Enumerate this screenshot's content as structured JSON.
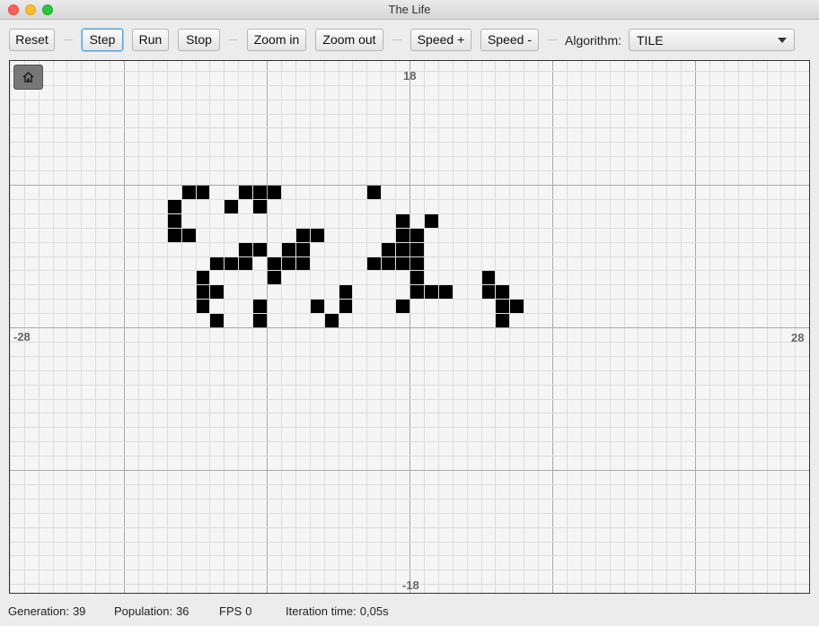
{
  "window": {
    "title": "The Life"
  },
  "toolbar": {
    "reset_label": "Reset",
    "step_label": "Step",
    "run_label": "Run",
    "stop_label": "Stop",
    "zoom_in_label": "Zoom in",
    "zoom_out_label": "Zoom out",
    "speed_plus_label": "Speed +",
    "speed_minus_label": "Speed -",
    "algorithm_label": "Algorithm:",
    "algorithm_value": "TILE"
  },
  "grid": {
    "axis_labels": {
      "top": "18",
      "bottom": "-18",
      "left": "-28",
      "right": "28"
    },
    "x_range": [
      -28,
      28
    ],
    "y_range": [
      -18,
      18
    ],
    "major_every": 10,
    "live_cells": [
      [
        -14,
        1
      ],
      [
        -11,
        1
      ],
      [
        -6,
        1
      ],
      [
        6,
        1
      ],
      [
        -15,
        2
      ],
      [
        -11,
        2
      ],
      [
        -7,
        2
      ],
      [
        -5,
        2
      ],
      [
        -1,
        2
      ],
      [
        6,
        2
      ],
      [
        7,
        2
      ],
      [
        -15,
        3
      ],
      [
        -14,
        3
      ],
      [
        -5,
        3
      ],
      [
        0,
        3
      ],
      [
        1,
        3
      ],
      [
        2,
        3
      ],
      [
        5,
        3
      ],
      [
        6,
        3
      ],
      [
        -15,
        4
      ],
      [
        -10,
        4
      ],
      [
        0,
        4
      ],
      [
        5,
        4
      ],
      [
        -14,
        5
      ],
      [
        -13,
        5
      ],
      [
        -12,
        5
      ],
      [
        -10,
        5
      ],
      [
        -9,
        5
      ],
      [
        -8,
        5
      ],
      [
        -3,
        5
      ],
      [
        -2,
        5
      ],
      [
        -1,
        5
      ],
      [
        0,
        5
      ],
      [
        -12,
        6
      ],
      [
        -11,
        6
      ],
      [
        -9,
        6
      ],
      [
        -8,
        6
      ],
      [
        -2,
        6
      ],
      [
        -1,
        6
      ],
      [
        0,
        6
      ],
      [
        -17,
        7
      ],
      [
        -16,
        7
      ],
      [
        -8,
        7
      ],
      [
        -7,
        7
      ],
      [
        -1,
        7
      ],
      [
        0,
        7
      ],
      [
        -17,
        8
      ],
      [
        -1,
        8
      ],
      [
        1,
        8
      ],
      [
        -17,
        9
      ],
      [
        -13,
        9
      ],
      [
        -11,
        9
      ],
      [
        -16,
        10
      ],
      [
        -15,
        10
      ],
      [
        -12,
        10
      ],
      [
        -11,
        10
      ],
      [
        -10,
        10
      ],
      [
        -3,
        10
      ]
    ]
  },
  "status": {
    "generation_label": "Generation:",
    "generation_value": "39",
    "population_label": "Population:",
    "population_value": "36",
    "fps_label": "FPS",
    "fps_value": "0",
    "iteration_time_label": "Iteration time:",
    "iteration_time_value": "0,05s"
  },
  "colors": {
    "cell": "#000000",
    "grid_minor": "#dcdcdc",
    "grid_major": "#a9a9a9",
    "canvas_bg": "#f5f5f5"
  }
}
